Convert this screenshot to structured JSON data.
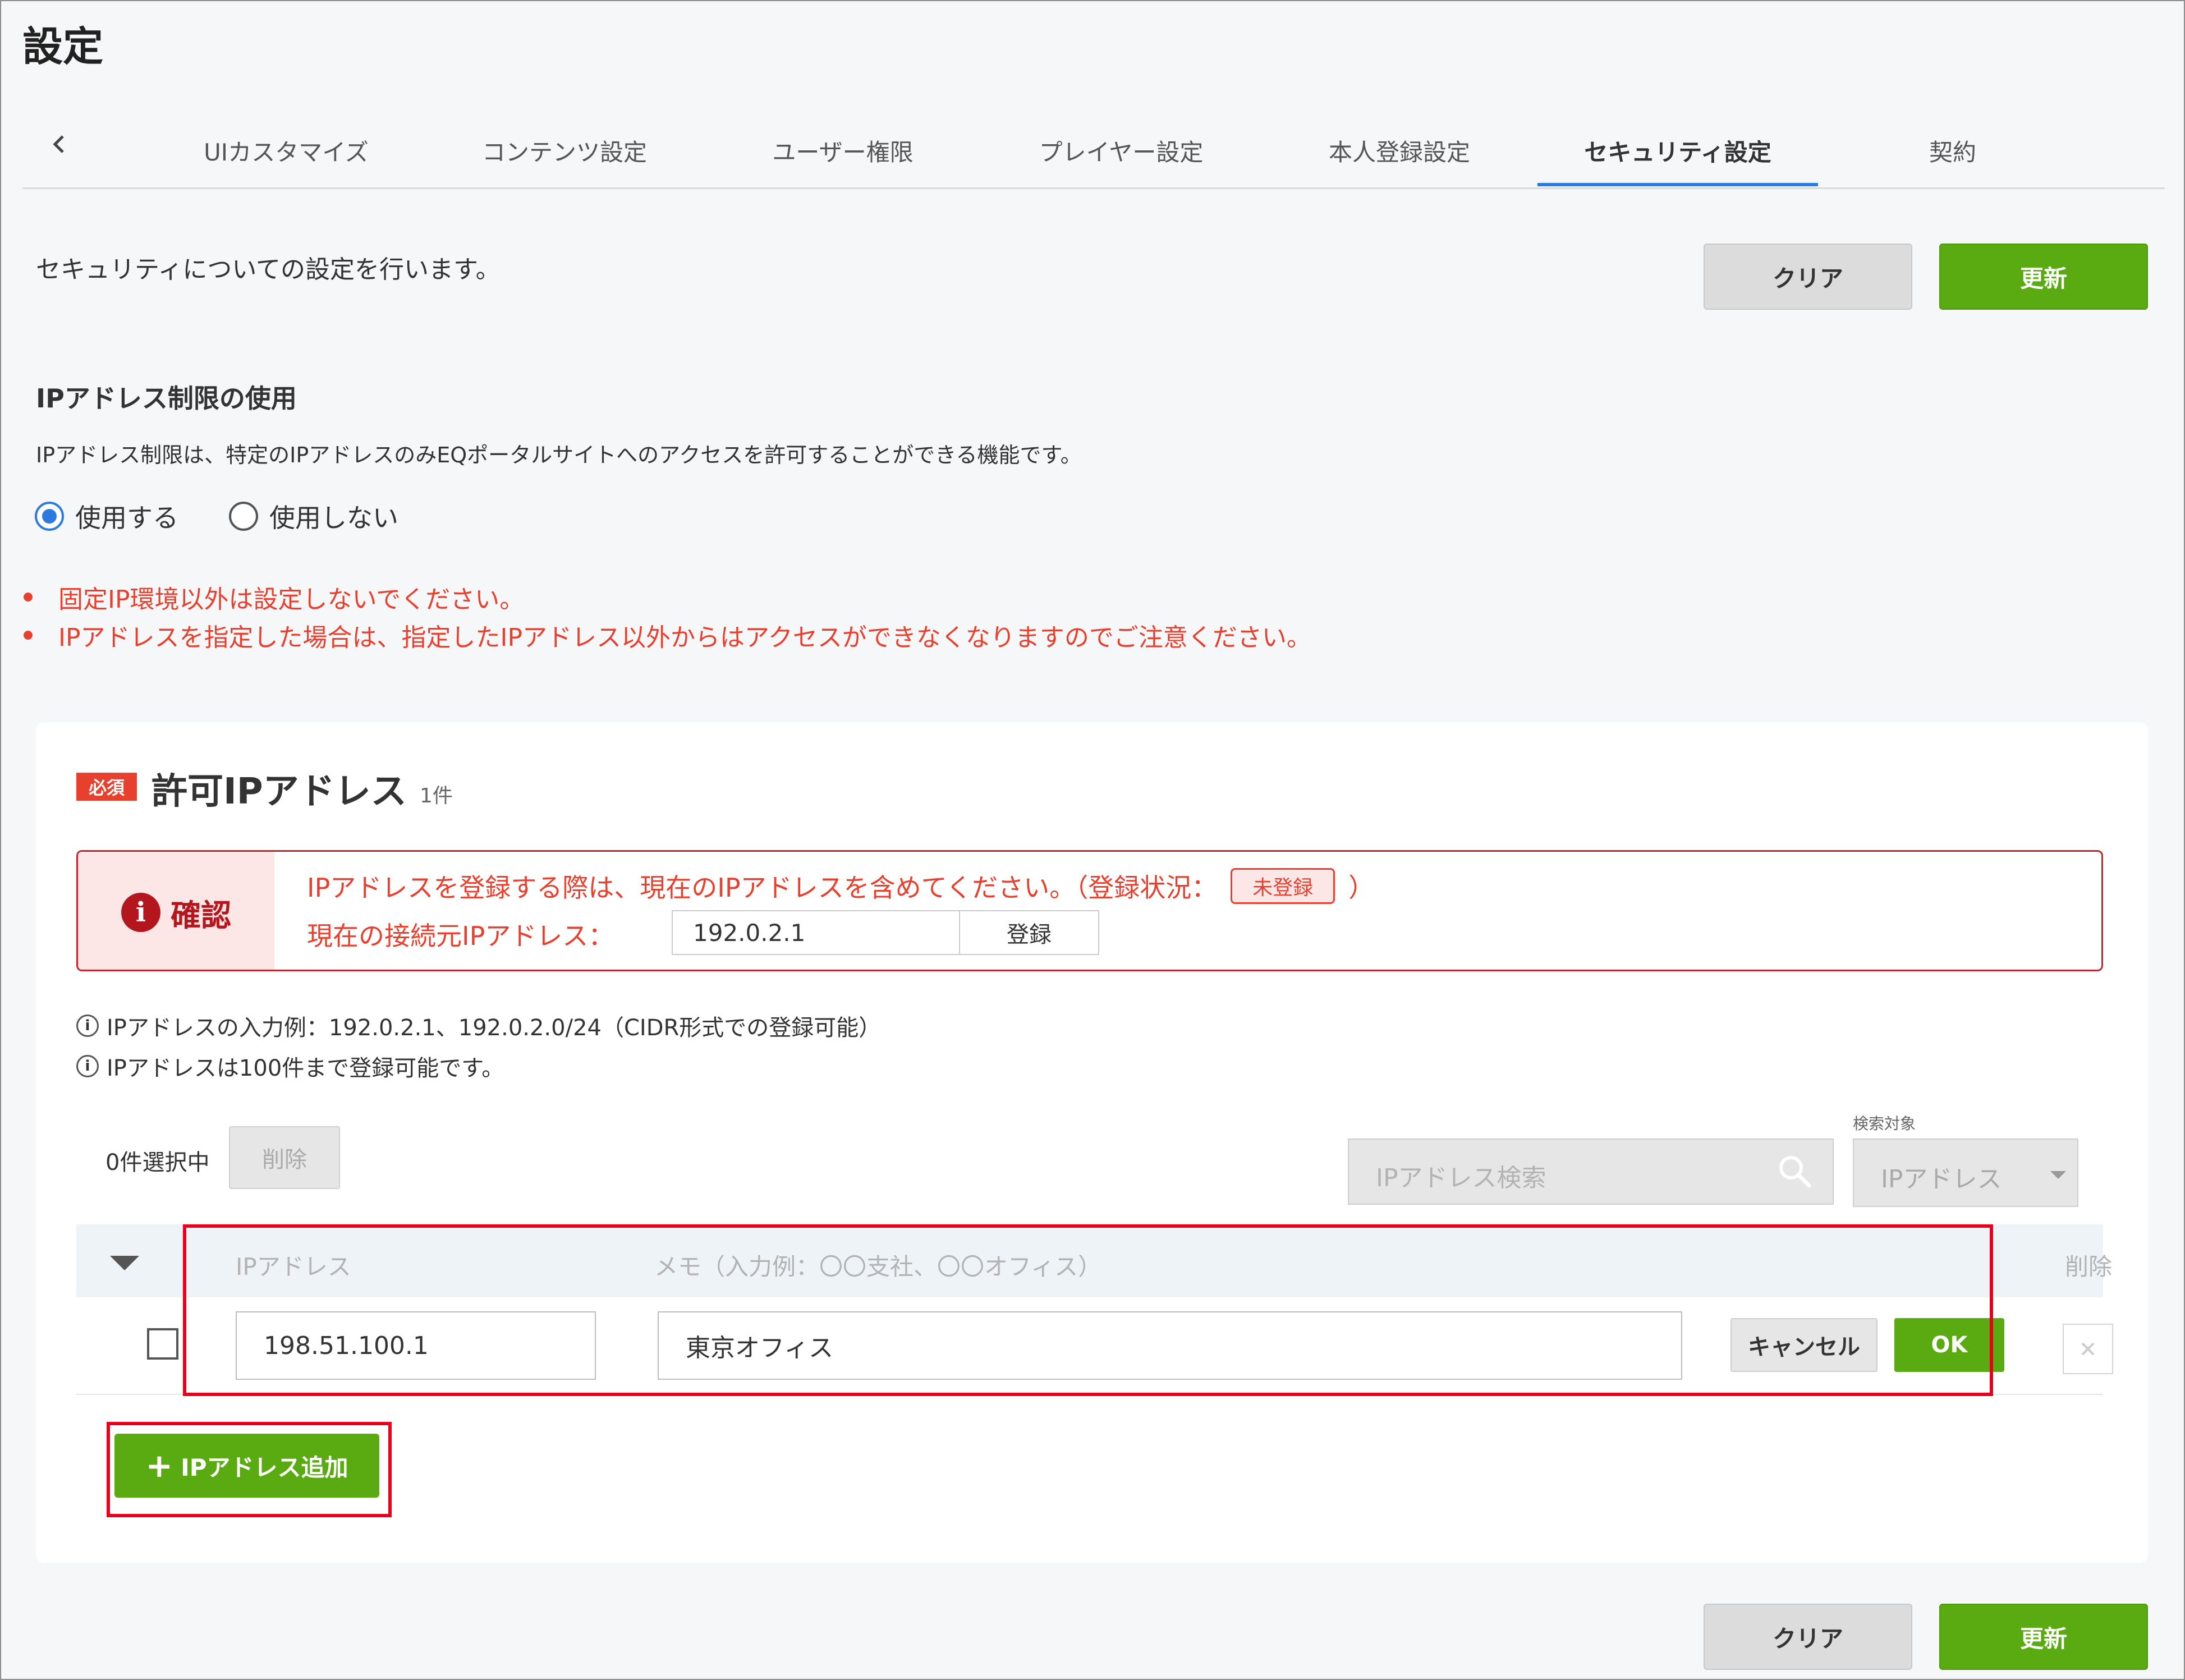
{
  "page": {
    "title": "設定"
  },
  "tabs": {
    "back_icon": "chevron-left-icon",
    "items": [
      {
        "label": "UIカスタマイズ"
      },
      {
        "label": "コンテンツ設定"
      },
      {
        "label": "ユーザー権限"
      },
      {
        "label": "プレイヤー設定"
      },
      {
        "label": "本人登録設定"
      },
      {
        "label": "セキュリティ設定"
      },
      {
        "label": "契約"
      }
    ],
    "active": "セキュリティ設定"
  },
  "header": {
    "description": "セキュリティについての設定を行います。",
    "clear_label": "クリア",
    "update_label": "更新"
  },
  "ip_restriction": {
    "title": "IPアドレス制限の使用",
    "description": "IPアドレス制限は、特定のIPアドレスのみEQポータルサイトへのアクセスを許可することができる機能です。",
    "options": [
      {
        "label": "使用する",
        "checked": true
      },
      {
        "label": "使用しない",
        "checked": false
      }
    ],
    "warnings": [
      "固定IP環境以外は設定しないでください。",
      "IPアドレスを指定した場合は、指定したIPアドレス以外からはアクセスができなくなりますのでご注意ください。"
    ]
  },
  "allowed_ip": {
    "required_badge": "必須",
    "title": "許可IPアドレス",
    "count": "1件",
    "confirm": {
      "label": "確認",
      "icon": "info-filled-icon",
      "message": "IPアドレスを登録する際は、現在のIPアドレスを含めてください。（登録状況：",
      "status_badge": "未登録",
      "message_end": "）",
      "current_label": "現在の接続元IPアドレス：",
      "current_ip": "192.0.2.1",
      "register_label": "登録"
    },
    "info": [
      "IPアドレスの入力例：192.0.2.1、192.0.2.0/24（CIDR形式での登録可能）",
      "IPアドレスは100件まで登録可能です。"
    ],
    "selection_count": "0件選択中",
    "delete_label": "削除",
    "search": {
      "placeholder": "IPアドレス検索",
      "target_label": "検索対象",
      "target_value": "IPアドレス"
    },
    "table": {
      "headers": {
        "ip": "IPアドレス",
        "memo": "メモ（入力例：〇〇支社、〇〇オフィス）",
        "delete": "削除"
      },
      "rows": [
        {
          "ip": "198.51.100.1",
          "memo": "東京オフィス",
          "cancel_label": "キャンセル",
          "ok_label": "OK"
        }
      ]
    },
    "add_label": "IPアドレス追加"
  },
  "footer": {
    "clear_label": "クリア",
    "update_label": "更新"
  },
  "colors": {
    "accent_green": "#5aab12",
    "warning_red": "#e8402f",
    "tab_active": "#2a7ae2",
    "highlight_red": "#e8001c"
  }
}
